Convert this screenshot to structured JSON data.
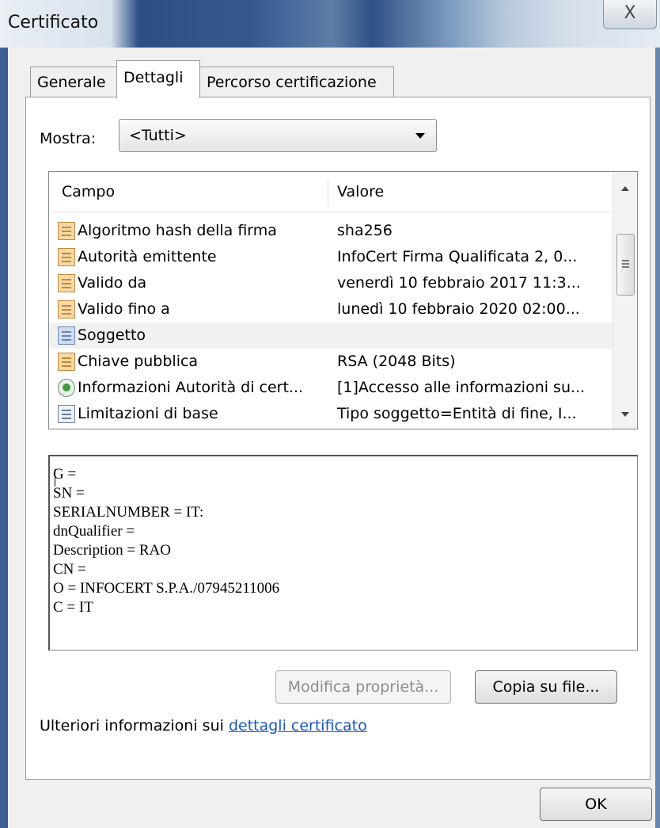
{
  "window": {
    "title": "Certificato",
    "close_glyph": "X"
  },
  "tabs": [
    {
      "label": "Generale",
      "active": false
    },
    {
      "label": "Dettagli",
      "active": true
    },
    {
      "label": "Percorso certificazione",
      "active": false
    }
  ],
  "mostra": {
    "label": "Mostra:",
    "selected": "<Tutti>"
  },
  "list": {
    "columns": [
      "Campo",
      "Valore"
    ],
    "rows": [
      {
        "campo": "Algoritmo hash della firma",
        "valore": "sha256",
        "icon": "field-icon",
        "selected": false
      },
      {
        "campo": "Autorità emittente",
        "valore": "InfoCert Firma Qualificata 2, 0...",
        "icon": "field-icon",
        "selected": false
      },
      {
        "campo": "Valido da",
        "valore": "venerdì 10 febbraio 2017 11:3...",
        "icon": "field-icon",
        "selected": false
      },
      {
        "campo": "Valido fino a",
        "valore": "lunedì 10 febbraio 2020 02:00...",
        "icon": "field-icon",
        "selected": false
      },
      {
        "campo": "Soggetto",
        "valore": "",
        "icon": "field-icon",
        "selected": true
      },
      {
        "campo": "Chiave pubblica",
        "valore": "RSA (2048 Bits)",
        "icon": "field-icon",
        "selected": false
      },
      {
        "campo": "Informazioni Autorità di cert...",
        "valore": "[1]Accesso alle informazioni su...",
        "icon": "extension-icon",
        "selected": false
      },
      {
        "campo": "Limitazioni di base",
        "valore": "Tipo soggetto=Entità di fine, I...",
        "icon": "extension-icon",
        "selected": false
      }
    ]
  },
  "details": {
    "lines": [
      "G =",
      "SN =",
      "SERIALNUMBER = IT:",
      "dnQualifier =",
      "Description = RAO",
      "CN =",
      "O = INFOCERT S.P.A./07945211006",
      "C = IT"
    ]
  },
  "buttons": {
    "modifica": "Modifica proprietà...",
    "copia": "Copia su file...",
    "ok": "OK"
  },
  "info": {
    "prefix": "Ulteriori informazioni sui ",
    "link": "dettagli certificato"
  }
}
